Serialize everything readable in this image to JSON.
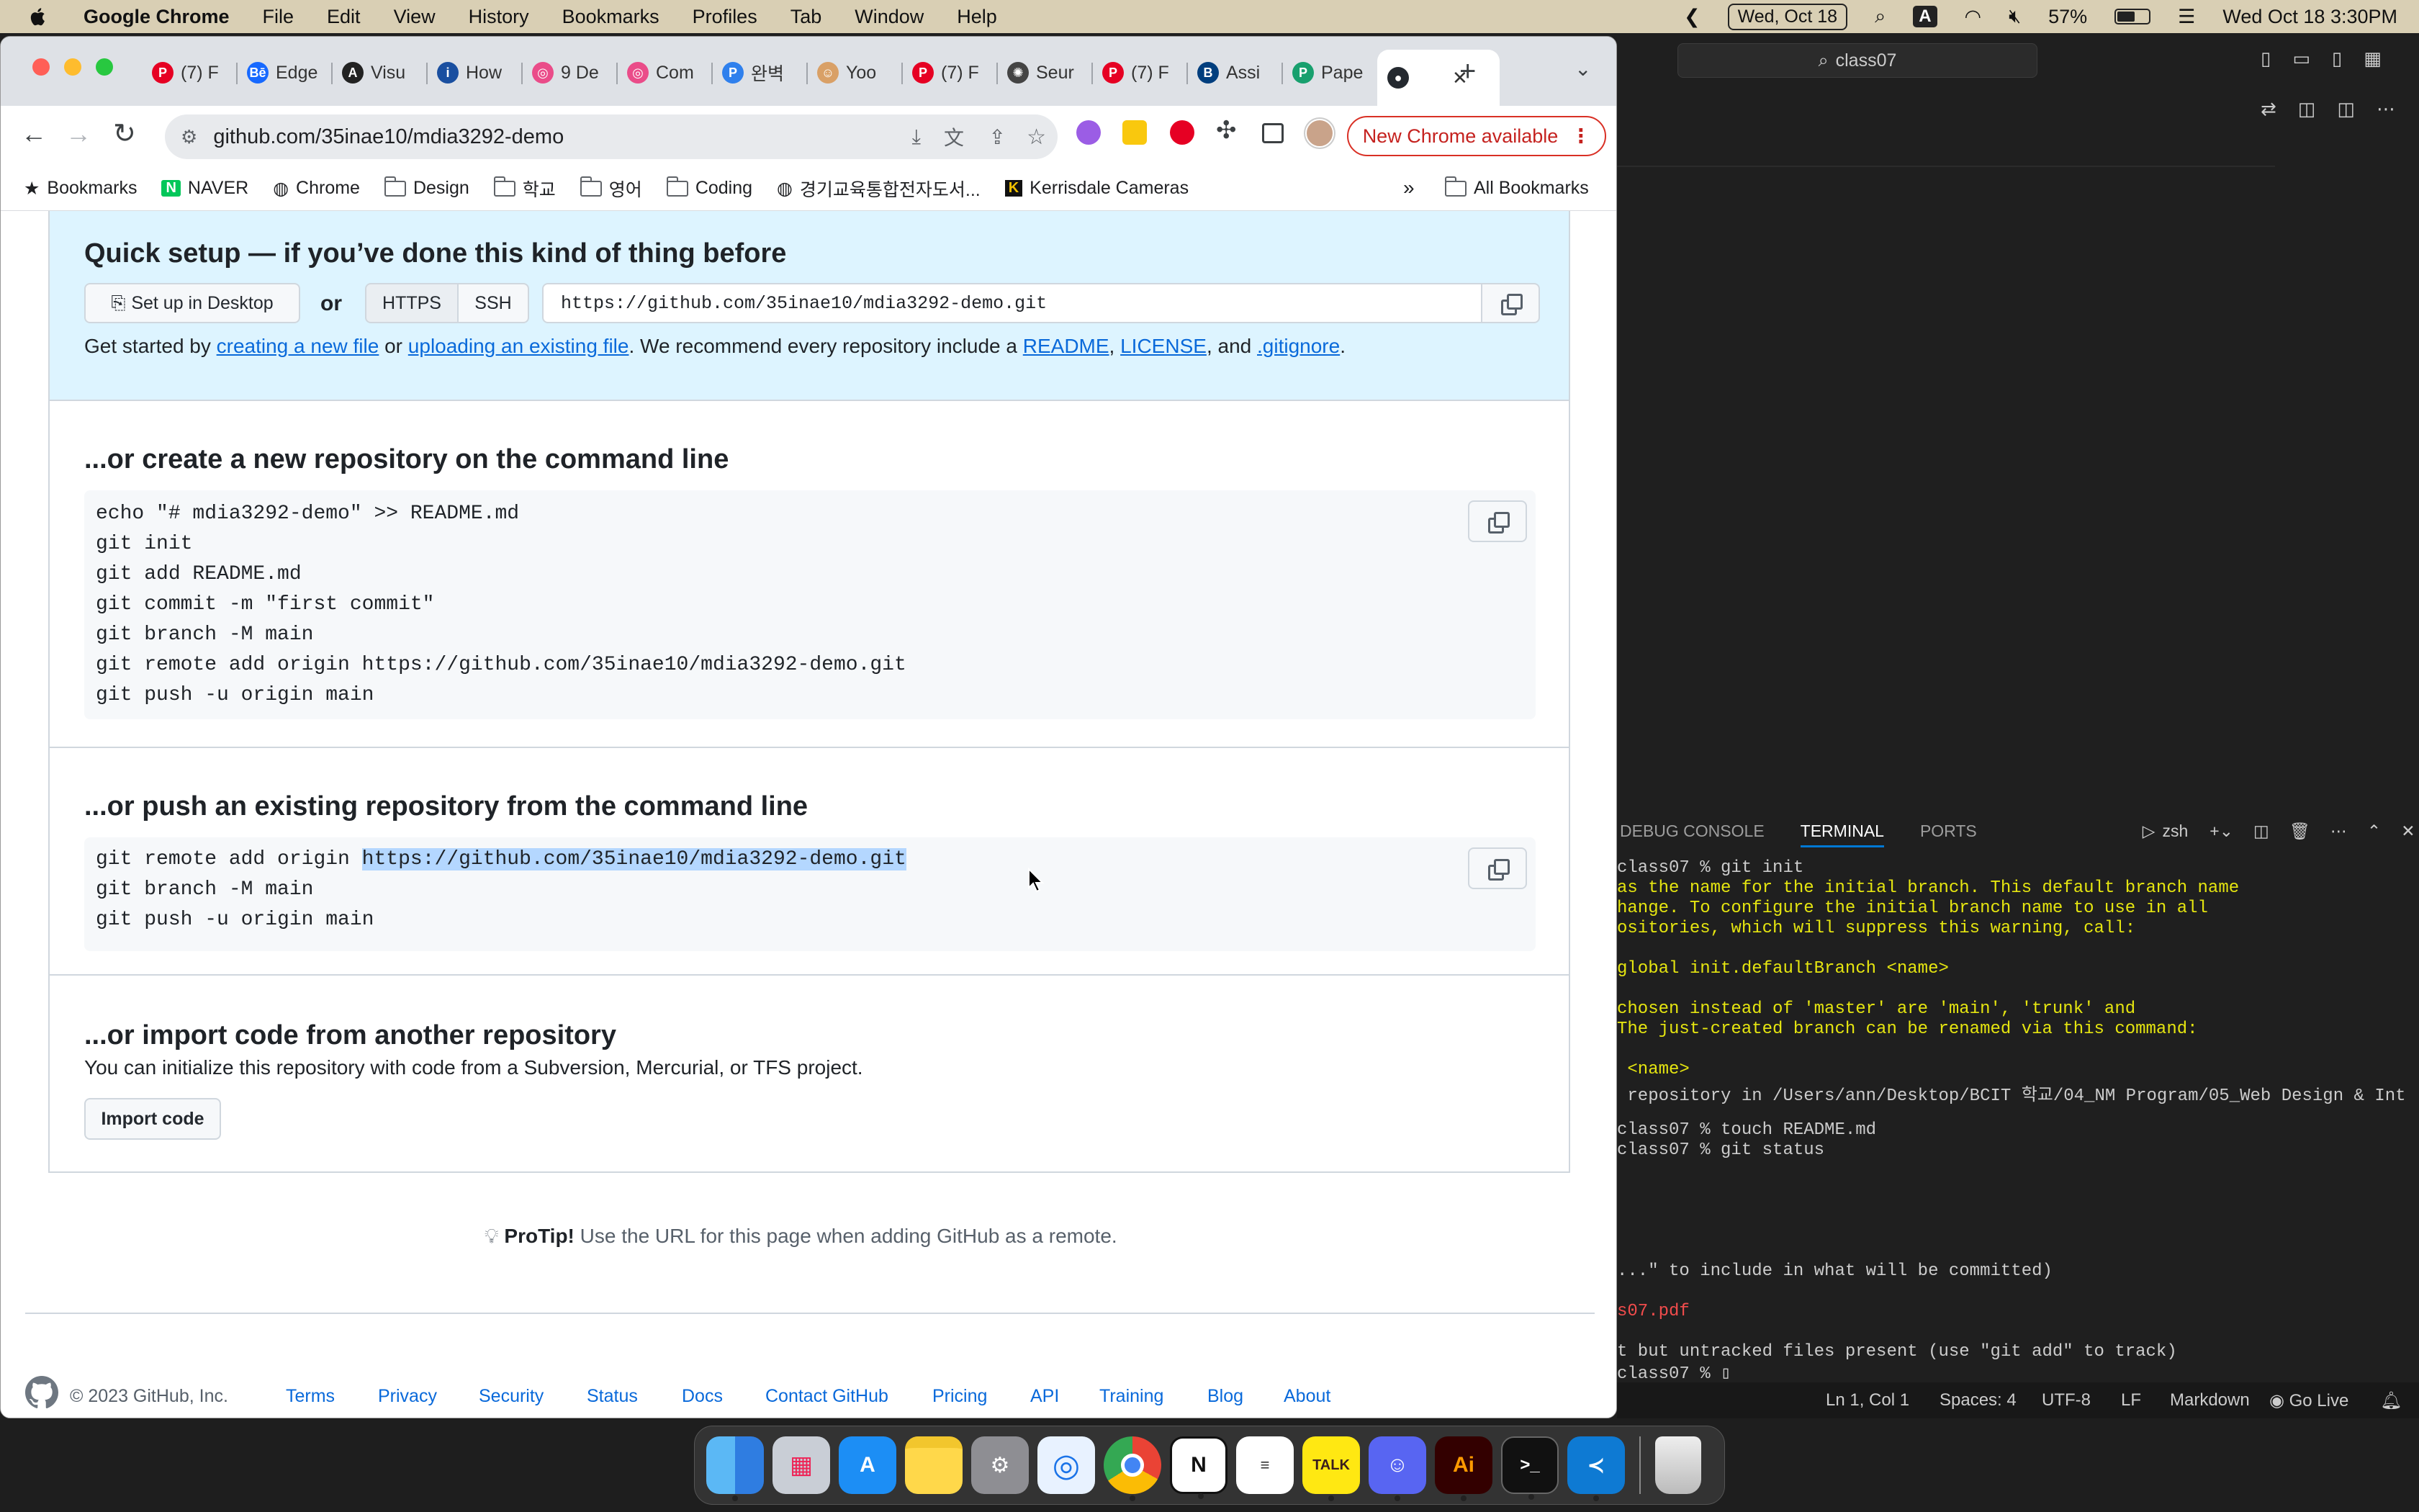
{
  "menubar": {
    "app_name": "Google Chrome",
    "menus": [
      "File",
      "Edit",
      "View",
      "History",
      "Bookmarks",
      "Profiles",
      "Tab",
      "Window",
      "Help"
    ],
    "date_pill": "Wed, Oct 18",
    "input_indicator": "A",
    "battery_percent": "57%",
    "clock": "Wed Oct 18  3:30PM"
  },
  "chrome": {
    "tabs": [
      {
        "label": "(7) F",
        "icon": "pinterest-icon"
      },
      {
        "label": "Edge",
        "icon": "behance-icon"
      },
      {
        "label": "Visu",
        "icon": "a-icon"
      },
      {
        "label": "How",
        "icon": "info-icon"
      },
      {
        "label": "9 De",
        "icon": "dribbble-icon"
      },
      {
        "label": "Com",
        "icon": "dribbble-icon"
      },
      {
        "label": "완벽",
        "icon": "p-icon"
      },
      {
        "label": "Yoo",
        "icon": "avatar-icon"
      },
      {
        "label": "(7) F",
        "icon": "pinterest-icon"
      },
      {
        "label": "Seur",
        "icon": "sun-icon"
      },
      {
        "label": "(7) F",
        "icon": "pinterest-icon"
      },
      {
        "label": "Assi",
        "icon": "bcit-icon"
      },
      {
        "label": "Pape",
        "icon": "paperpile-icon"
      },
      {
        "label": "",
        "icon": "github-icon",
        "active": true
      }
    ],
    "url": "github.com/35inae10/mdia3292-demo",
    "new_chrome_label": "New Chrome available",
    "bookmarks": [
      "Bookmarks",
      "NAVER",
      "Chrome",
      "Design",
      "학교",
      "영어",
      "Coding",
      "경기교육통합전자도서...",
      "Kerrisdale Cameras"
    ],
    "all_bookmarks": "All Bookmarks",
    "overflow": "»"
  },
  "github": {
    "quick_setup_title": "Quick setup — if you’ve done this kind of thing before",
    "setup_desktop_label": "Set up in Desktop",
    "or_label": "or",
    "https_label": "HTTPS",
    "ssh_label": "SSH",
    "clone_url": "https://github.com/35inae10/mdia3292-demo.git",
    "get_started_prefix": "Get started by ",
    "creating_link": "creating a new file",
    "or_text": " or ",
    "uploading_link": "uploading an existing file",
    "recommend_text": ". We recommend every repository include a ",
    "readme_link": "README",
    "comma": ", ",
    "license_link": "LICENSE",
    "and_text": ", and ",
    "gitignore_link": ".gitignore",
    "period": ".",
    "create_title": "...or create a new repository on the command line",
    "create_lines": [
      "echo \"# mdia3292-demo\" >> README.md",
      "git init",
      "git add README.md",
      "git commit -m \"first commit\"",
      "git branch -M main",
      "git remote add origin https://github.com/35inae10/mdia3292-demo.git",
      "git push -u origin main"
    ],
    "push_title": "...or push an existing repository from the command line",
    "push_line1_prefix": "git remote add origin ",
    "push_line1_url": "https://github.com/35inae10/mdia3292-demo.git",
    "push_lines_rest": [
      "git branch -M main",
      "git push -u origin main"
    ],
    "import_title": "...or import code from another repository",
    "import_text": "You can initialize this repository with code from a Subversion, Mercurial, or TFS project.",
    "import_button": "Import code",
    "protip_label": "ProTip!",
    "protip_text": " Use the URL for this page when adding GitHub as a remote.",
    "footer_copyright": "© 2023 GitHub, Inc.",
    "footer_links": [
      "Terms",
      "Privacy",
      "Security",
      "Status",
      "Docs",
      "Contact GitHub",
      "Pricing",
      "API",
      "Training",
      "Blog",
      "About"
    ]
  },
  "vscode": {
    "search_text": "class07",
    "panel_tabs": [
      "DEBUG CONSOLE",
      "TERMINAL",
      "PORTS"
    ],
    "shell": "zsh",
    "terminal_lines": [
      {
        "text": "class07 % git init",
        "color": "#cccccc"
      },
      {
        "text": "as the name for the initial branch. This default branch name",
        "color": "#e5e510"
      },
      {
        "text": "hange. To configure the initial branch name to use in all",
        "color": "#e5e510"
      },
      {
        "text": "ositories, which will suppress this warning, call:",
        "color": "#e5e510"
      },
      {
        "text": "",
        "color": "#e5e510"
      },
      {
        "text": "global init.defaultBranch <name>",
        "color": "#e5e510"
      },
      {
        "text": "",
        "color": "#e5e510"
      },
      {
        "text": "chosen instead of 'master' are 'main', 'trunk' and",
        "color": "#e5e510"
      },
      {
        "text": "The just-created branch can be renamed via this command:",
        "color": "#e5e510"
      },
      {
        "text": "",
        "color": "#e5e510"
      },
      {
        "text": " <name>",
        "color": "#e5e510"
      },
      {
        "text": " repository in /Users/ann/Desktop/BCIT 학교/04_NM Program/05_Web Design & Int",
        "color": "#cccccc"
      },
      {
        "text": "",
        "color": "#cccccc"
      },
      {
        "text": "class07 % touch README.md",
        "color": "#cccccc"
      },
      {
        "text": "class07 % git status",
        "color": "#cccccc"
      }
    ],
    "terminal_tail": [
      {
        "text": "...\" to include in what will be committed)",
        "color": "#cccccc"
      },
      {
        "text": "",
        "color": "#cccccc"
      },
      {
        "text": "s07.pdf",
        "color": "#f14c4c"
      },
      {
        "text": "",
        "color": "#cccccc"
      },
      {
        "text": "t but untracked files present (use \"git add\" to track)",
        "color": "#cccccc"
      },
      {
        "text": "class07 % ▯",
        "color": "#cccccc"
      }
    ],
    "status_items": [
      "Ln 1, Col 1",
      "Spaces: 4",
      "UTF-8",
      "LF",
      "Markdown",
      "Go Live"
    ]
  },
  "dock": {
    "apps": [
      "Finder",
      "Launchpad",
      "App Store",
      "Notes",
      "System Settings",
      "Safari",
      "Chrome",
      "Notion",
      "Reminders",
      "KakaoTalk",
      "Discord",
      "Illustrator",
      "Terminal",
      "VS Code",
      "Trash"
    ],
    "talk_label": "TALK",
    "ai_label": "Ai",
    "notion_label": "N",
    "terminal_label": ">_"
  }
}
